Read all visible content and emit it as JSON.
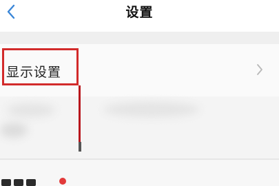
{
  "header": {
    "title": "设置",
    "back_icon": "chevron-left-icon"
  },
  "rows": [
    {
      "label": "显示设置",
      "icon": "chevron-right-icon"
    }
  ],
  "colors": {
    "accent": "#3a86d8",
    "highlight": "#d22a2a"
  }
}
